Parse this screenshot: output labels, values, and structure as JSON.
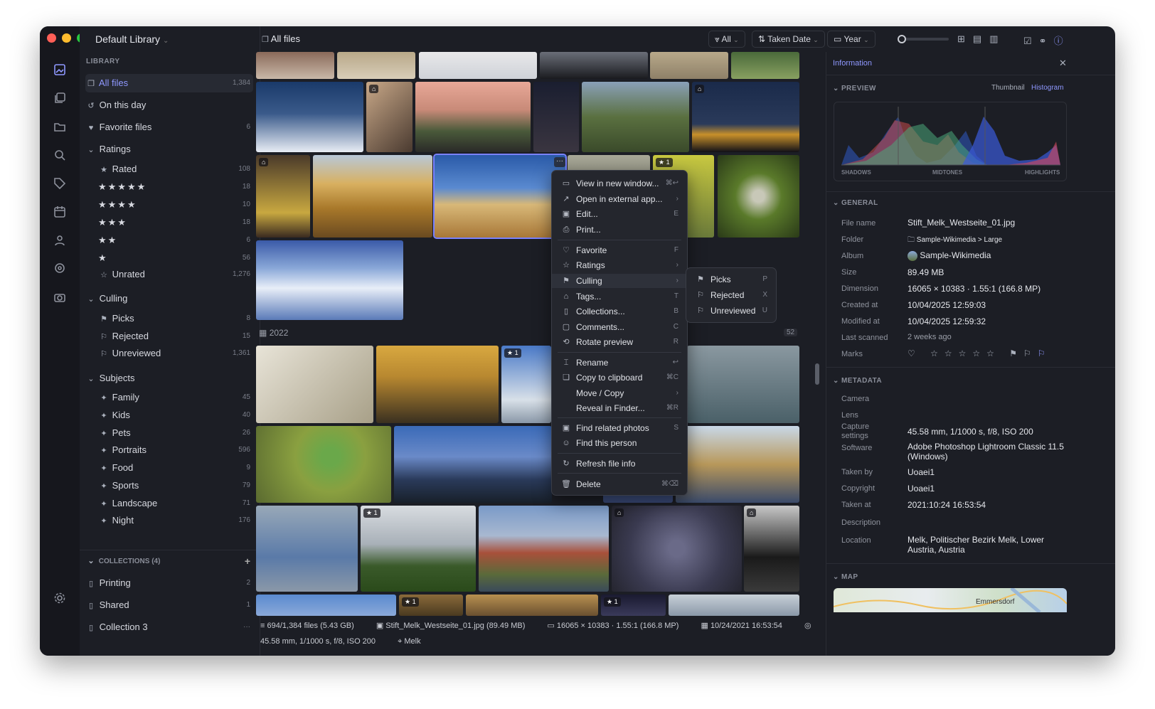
{
  "window": {
    "library_title": "Default Library",
    "view_title": "All files"
  },
  "toolbar": {
    "filter_label": "All",
    "sort_label": "Taken Date",
    "group_label": "Year"
  },
  "sidebar": {
    "library_heading": "LIBRARY",
    "items": [
      {
        "label": "All files",
        "count": "1,384"
      },
      {
        "label": "On this day",
        "count": ""
      },
      {
        "label": "Favorite files",
        "count": "6"
      }
    ],
    "ratings": {
      "heading": "Ratings",
      "items": [
        {
          "label": "Rated",
          "count": "108"
        },
        {
          "label": "★★★★★",
          "count": "18"
        },
        {
          "label": "★★★★",
          "count": "10"
        },
        {
          "label": "★★★",
          "count": "18"
        },
        {
          "label": "★★",
          "count": "6"
        },
        {
          "label": "★",
          "count": "56"
        },
        {
          "label": "Unrated",
          "count": "1,276"
        }
      ]
    },
    "culling": {
      "heading": "Culling",
      "items": [
        {
          "label": "Picks",
          "count": "8"
        },
        {
          "label": "Rejected",
          "count": "15"
        },
        {
          "label": "Unreviewed",
          "count": "1,361"
        }
      ]
    },
    "subjects": {
      "heading": "Subjects",
      "items": [
        {
          "label": "Family",
          "count": "45"
        },
        {
          "label": "Kids",
          "count": "40"
        },
        {
          "label": "Pets",
          "count": "26"
        },
        {
          "label": "Portraits",
          "count": "596"
        },
        {
          "label": "Food",
          "count": "9"
        },
        {
          "label": "Sports",
          "count": "79"
        },
        {
          "label": "Landscape",
          "count": "71"
        },
        {
          "label": "Night",
          "count": "176"
        }
      ]
    },
    "collections": {
      "heading": "COLLECTIONS (4)",
      "items": [
        {
          "label": "Printing",
          "count": "2"
        },
        {
          "label": "Shared",
          "count": "1"
        },
        {
          "label": "Collection 3",
          "count": "···"
        }
      ]
    }
  },
  "grid": {
    "year_label": "2022",
    "year_count": "52",
    "badge_one": "1"
  },
  "context_menu": [
    {
      "label": "View in new window...",
      "shortcut": "⌘↩"
    },
    {
      "label": "Open in external app...",
      "shortcut": "›"
    },
    {
      "label": "Edit...",
      "shortcut": "E"
    },
    {
      "label": "Print...",
      "shortcut": ""
    },
    {
      "label": "Favorite",
      "shortcut": "F"
    },
    {
      "label": "Ratings",
      "shortcut": "›"
    },
    {
      "label": "Culling",
      "shortcut": "›"
    },
    {
      "label": "Tags...",
      "shortcut": "T"
    },
    {
      "label": "Collections...",
      "shortcut": "B"
    },
    {
      "label": "Comments...",
      "shortcut": "C"
    },
    {
      "label": "Rotate preview",
      "shortcut": "R"
    },
    {
      "label": "Rename",
      "shortcut": "↩"
    },
    {
      "label": "Copy to clipboard",
      "shortcut": "⌘C"
    },
    {
      "label": "Move / Copy",
      "shortcut": "›"
    },
    {
      "label": "Reveal in Finder...",
      "shortcut": "⌘R"
    },
    {
      "label": "Find related photos",
      "shortcut": "S"
    },
    {
      "label": "Find this person",
      "shortcut": ""
    },
    {
      "label": "Refresh file info",
      "shortcut": ""
    },
    {
      "label": "Delete",
      "shortcut": "⌘⌫"
    }
  ],
  "culling_submenu": [
    {
      "label": "Picks",
      "shortcut": "P"
    },
    {
      "label": "Rejected",
      "shortcut": "X"
    },
    {
      "label": "Unreviewed",
      "shortcut": "U"
    }
  ],
  "info": {
    "title": "Information",
    "preview_heading": "PREVIEW",
    "tab_thumbnail": "Thumbnail",
    "tab_histogram": "Histogram",
    "hist_shadows": "SHADOWS",
    "hist_midtones": "MIDTONES",
    "hist_highlights": "HIGHLIGHTS",
    "general_heading": "GENERAL",
    "general": [
      {
        "label": "File name",
        "value": "Stift_Melk_Westseite_01.jpg"
      },
      {
        "label": "Folder",
        "value": "Sample-Wikimedia > Large"
      },
      {
        "label": "Album",
        "value": "Sample-Wikimedia"
      },
      {
        "label": "Size",
        "value": "89.49 MB"
      },
      {
        "label": "Dimension",
        "value": "16065 × 10383 · 1.55:1 (166.8 MP)"
      },
      {
        "label": "Created at",
        "value": "10/04/2025 12:59:03"
      },
      {
        "label": "Modified at",
        "value": "10/04/2025 12:59:32"
      },
      {
        "label": "Last scanned",
        "value": "2 weeks ago"
      },
      {
        "label": "Marks",
        "value": ""
      }
    ],
    "metadata_heading": "METADATA",
    "metadata": [
      {
        "label": "Camera",
        "value": ""
      },
      {
        "label": "Lens",
        "value": ""
      },
      {
        "label": "Capture settings",
        "value": "45.58 mm, 1/1000 s, f/8, ISO 200"
      },
      {
        "label": "Software",
        "value": "Adobe Photoshop Lightroom Classic 11.5 (Windows)"
      },
      {
        "label": "Taken by",
        "value": "Uoaei1"
      },
      {
        "label": "Copyright",
        "value": "Uoaei1"
      },
      {
        "label": "Taken at",
        "value": "2021:10:24 16:53:54"
      },
      {
        "label": "Description",
        "value": ""
      },
      {
        "label": "Location",
        "value": "Melk, Politischer Bezirk Melk, Lower Austria, Austria"
      }
    ],
    "map_heading": "MAP",
    "map_label": "Emmersdorf"
  },
  "status": {
    "files": "694/1,384 files (5.43 GB)",
    "file": "Stift_Melk_Westseite_01.jpg (89.49 MB)",
    "dimension": "16065 × 10383 · 1.55:1 (166.8 MP)",
    "date": "10/24/2021 16:53:54",
    "capture": "45.58 mm, 1/1000 s, f/8, ISO 200",
    "location": "Melk"
  }
}
